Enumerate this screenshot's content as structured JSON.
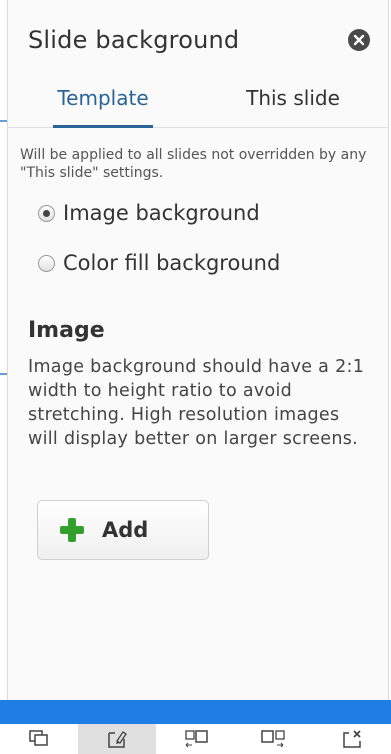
{
  "panel": {
    "title": "Slide background",
    "close_icon": "close-circle-icon"
  },
  "tabs": [
    {
      "label": "Template",
      "active": true
    },
    {
      "label": "This slide",
      "active": false
    }
  ],
  "note": "Will be applied to all slides not overridden by any \"This slide\" settings.",
  "background_options": [
    {
      "label": "Image background",
      "checked": true
    },
    {
      "label": "Color fill background",
      "checked": false
    }
  ],
  "image_section": {
    "title": "Image",
    "description": "Image background should have a 2:1 width to height ratio to avoid stretching. High resolution images will display better on larger screens.",
    "add_button": "Add",
    "add_icon": "plus-icon"
  },
  "toolbar": {
    "items": [
      {
        "icon": "duplicate-slide-icon",
        "active": false
      },
      {
        "icon": "slide-background-icon",
        "active": true
      },
      {
        "icon": "move-slide-left-icon",
        "active": false
      },
      {
        "icon": "move-slide-right-icon",
        "active": false
      },
      {
        "icon": "delete-slide-icon",
        "active": false
      }
    ]
  },
  "colors": {
    "accent": "#2a6496",
    "bottom_bar": "#1e7ee6",
    "add_icon": "#33a02c"
  }
}
